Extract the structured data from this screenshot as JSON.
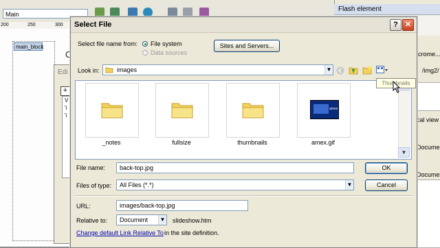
{
  "background": {
    "template_select": "Main",
    "ruler_ticks": [
      "200",
      "250",
      "300"
    ],
    "main_block": "main_block",
    "edit_title": "Edi",
    "edit_list": [
      "V",
      "'i",
      "'i"
    ],
    "c_letter": "C",
    "panel_tab": "Flash element",
    "panel_texts": [
      "icrome...",
      "/img2/",
      "cal view",
      "Documen",
      "Documen"
    ]
  },
  "dialog": {
    "title": "Select File",
    "help": "?",
    "close": "✕",
    "select_from_label": "Select file name from:",
    "radio_file_system": "File system",
    "radio_data_sources": "Data sources",
    "sites_button": "Sites and Servers...",
    "look_in_label": "Look in:",
    "look_in_value": "images",
    "files": [
      {
        "name": "_notes",
        "icon": "folder-icon"
      },
      {
        "name": "fullsize",
        "icon": "folder-icon"
      },
      {
        "name": "thumbnails",
        "icon": "folder-icon"
      },
      {
        "name": "amex.gif",
        "icon": "image-thumbnail"
      }
    ],
    "amex_text": "amex",
    "tooltip": "Thumbnails",
    "file_name_label": "File name:",
    "file_name_value": "back-top.jpg",
    "ok": "OK",
    "files_of_type_label": "Files of type:",
    "files_of_type_value": "All Files (*.*)",
    "cancel": "Cancel",
    "url_label": "URL:",
    "url_value": "images/back-top.jpg",
    "relative_label": "Relative to:",
    "relative_value": "Document",
    "relative_file": "slideshow.htm",
    "link_text": "Change default Link Relative To",
    "link_suffix": "in the site definition."
  },
  "colors": {
    "accent": "#003c74",
    "close": "#c8401e",
    "folder": "#f2d25e"
  }
}
